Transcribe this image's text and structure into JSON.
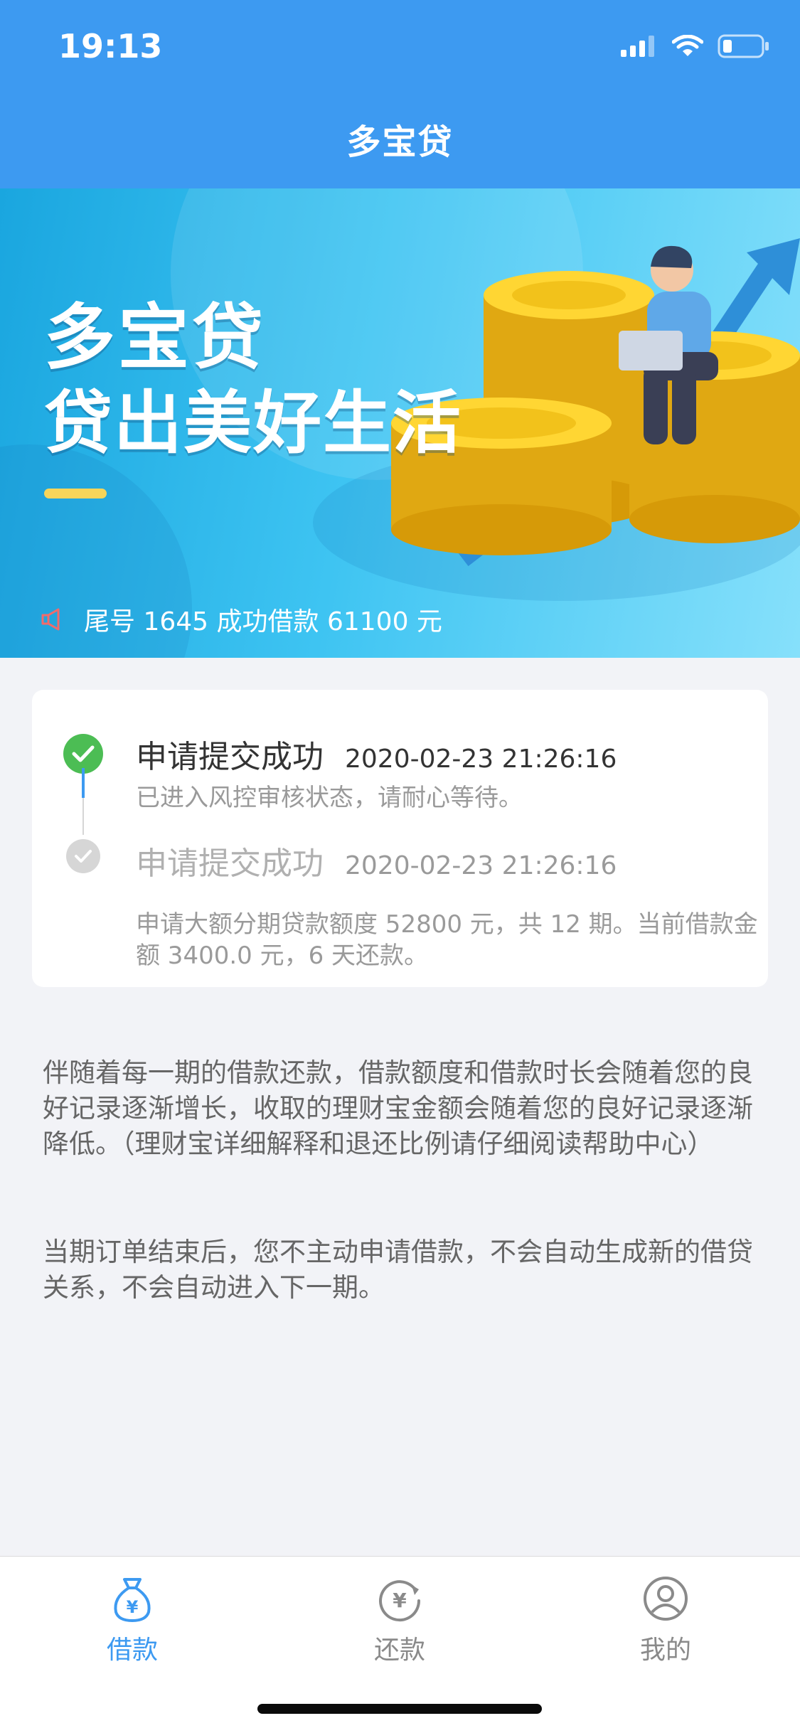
{
  "status_bar": {
    "time": "19:13",
    "icons": [
      "signal-icon",
      "wifi-icon",
      "battery-icon"
    ]
  },
  "nav": {
    "title": "多宝贷"
  },
  "banner": {
    "slogan_line1": "多宝贷",
    "slogan_line2": "贷出美好生活",
    "notice": "尾号 1645 成功借款 61100 元",
    "notice_icon": "megaphone-icon"
  },
  "timeline": {
    "steps": [
      {
        "title": "申请提交成功",
        "time": "2020-02-23 21:26:16",
        "desc": "已进入风控审核状态，请耐心等待。",
        "status": "done"
      },
      {
        "title": "申请提交成功",
        "time": "2020-02-23 21:26:16",
        "desc": "申请大额分期贷款额度 52800 元，共 12 期。当前借款金额 3400.0 元，6 天还款。",
        "status": "inactive"
      }
    ]
  },
  "info": {
    "paragraph1": "伴随着每一期的借款还款，借款额度和借款时长会随着您的良好记录逐渐增长，收取的理财宝金额会随着您的良好记录逐渐降低。（理财宝详细解释和退还比例请仔细阅读帮助中心）",
    "paragraph2": "当期订单结束后，您不主动申请借款，不会自动生成新的借贷关系，不会自动进入下一期。"
  },
  "tabbar": {
    "tabs": [
      {
        "label": "借款",
        "icon": "money-bag-icon",
        "active": true
      },
      {
        "label": "还款",
        "icon": "repay-yen-icon",
        "active": false
      },
      {
        "label": "我的",
        "icon": "user-icon",
        "active": false
      }
    ]
  },
  "colors": {
    "primary": "#3d9af1",
    "success": "#4cbd54",
    "inactive": "#d6d6d6",
    "text_dark": "#333333",
    "text_gray": "#9a9a9a"
  }
}
